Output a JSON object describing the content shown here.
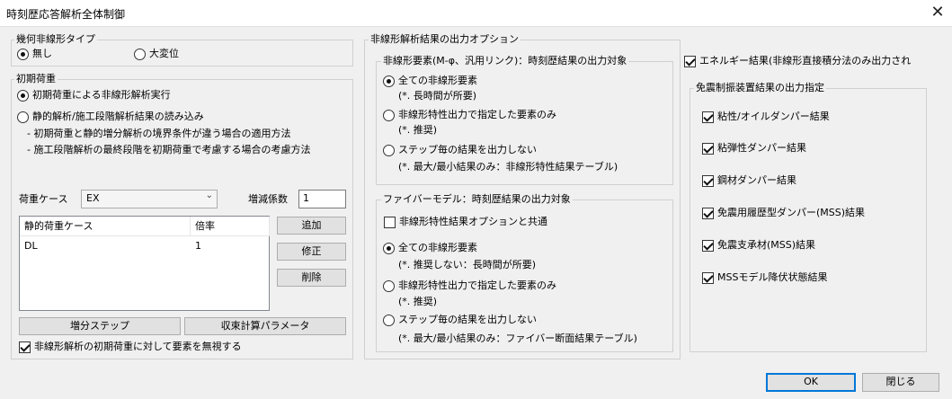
{
  "window": {
    "title": "時刻歴応答解析全体制御",
    "close_glyph": "✕"
  },
  "geom_nonlinear": {
    "label": "幾何非線形タイプ",
    "options": [
      {
        "label": "無し",
        "selected": true
      },
      {
        "label": "大変位",
        "selected": false
      }
    ]
  },
  "initial_load": {
    "label": "初期荷重",
    "option_run": "初期荷重による非線形解析実行",
    "option_read": "静的解析/施工段階解析結果の読み込み",
    "note1": "- 初期荷重と静的増分解析の境界条件が違う場合の適用方法",
    "note2": "- 施工段階解析の最終段階を初期荷重で考慮する場合の考慮方法",
    "load_case_label": "荷重ケース",
    "load_case_value": "EX",
    "factor_label": "増減係数",
    "factor_value": "1",
    "table": {
      "headers": [
        "静的荷重ケース",
        "倍率"
      ],
      "rows": [
        [
          "DL",
          "1"
        ]
      ]
    },
    "btn_add": "追加",
    "btn_modify": "修正",
    "btn_delete": "削除",
    "btn_increment": "増分ステップ",
    "btn_convergence": "収束計算パラメータ",
    "ignore_check": "非線形解析の初期荷重に対して要素を無視する"
  },
  "output_options": {
    "label": "非線形解析結果の出力オプション",
    "elements": {
      "label": "非線形要素(M-φ、汎用リンク)：時刻歴結果の出力対象",
      "opt1": "全ての非線形要素",
      "opt1_note": "(*. 長時間が所要)",
      "opt2": "非線形特性出力で指定した要素のみ",
      "opt2_note": "(*. 推奨)",
      "opt3": "ステップ毎の結果を出力しない",
      "opt3_note": "(*. 最大/最小結果のみ：非線形特性結果テーブル)"
    },
    "fiber": {
      "label": "ファイバーモデル：時刻歴結果の出力対象",
      "share": "非線形特性結果オプションと共通",
      "opt1": "全ての非線形要素",
      "opt1_note": "(*. 推奨しない：長時間が所要)",
      "opt2": "非線形特性出力で指定した要素のみ",
      "opt2_note": "(*. 推奨)",
      "opt3": "ステップ毎の結果を出力しない",
      "opt3_note": "(*. 最大/最小結果のみ：ファイバー断面結果テーブル)"
    }
  },
  "energy": {
    "label": "エネルギー結果(非線形直接積分法のみ出力され"
  },
  "damper": {
    "label": "免震制振装置結果の出力指定",
    "items": [
      "粘性/オイルダンパー結果",
      "粘弾性ダンパー結果",
      "鋼材ダンパー結果",
      "免震用履歴型ダンパー(MSS)結果",
      "免震支承材(MSS)結果",
      "MSSモデル降伏状態結果"
    ]
  },
  "footer": {
    "ok": "OK",
    "close": "閉じる"
  },
  "icons": {
    "combo_arrow": "chevron-down-icon",
    "close": "close-icon"
  }
}
